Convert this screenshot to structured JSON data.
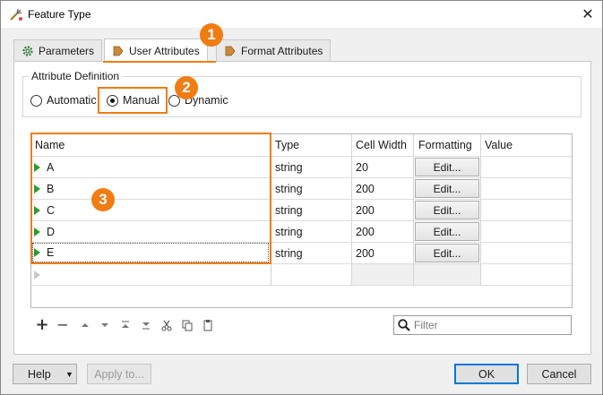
{
  "window": {
    "title": "Feature Type",
    "close_glyph": "✕"
  },
  "tabs": [
    {
      "label": "Parameters",
      "icon": "gear-icon",
      "active": false
    },
    {
      "label": "User Attributes",
      "icon": "arrow-tag-icon",
      "active": true
    },
    {
      "label": "Format Attributes",
      "icon": "arrow-tag-icon",
      "active": false
    }
  ],
  "attribute_definition": {
    "legend": "Attribute Definition",
    "options": [
      {
        "label": "Automatic",
        "selected": false
      },
      {
        "label": "Manual",
        "selected": true
      },
      {
        "label": "Dynamic",
        "selected": false
      }
    ]
  },
  "table": {
    "columns": [
      "Name",
      "Type",
      "Cell Width",
      "Formatting",
      "Value"
    ],
    "rows": [
      {
        "name": "A",
        "type": "string",
        "width": "20",
        "formatting": "Edit..."
      },
      {
        "name": "B",
        "type": "string",
        "width": "200",
        "formatting": "Edit..."
      },
      {
        "name": "C",
        "type": "string",
        "width": "200",
        "formatting": "Edit..."
      },
      {
        "name": "D",
        "type": "string",
        "width": "200",
        "formatting": "Edit..."
      },
      {
        "name": "E",
        "type": "string",
        "width": "200",
        "formatting": "Edit..."
      }
    ]
  },
  "toolbar": {
    "icons": [
      "add-icon",
      "remove-icon",
      "move-up-icon",
      "move-down-icon",
      "move-top-icon",
      "move-bottom-icon",
      "cut-icon",
      "copy-icon",
      "paste-icon"
    ],
    "add_glyph": "+",
    "remove_glyph": "−",
    "filter_placeholder": "Filter"
  },
  "footer": {
    "help_label": "Help",
    "help_arrow": "▼",
    "apply_label": "Apply to...",
    "ok_label": "OK",
    "cancel_label": "Cancel"
  },
  "callouts": [
    "1",
    "2",
    "3"
  ],
  "colors": {
    "accent": "#f07c12",
    "ok_border": "#0078d7",
    "row_marker": "#2e9a2e"
  }
}
